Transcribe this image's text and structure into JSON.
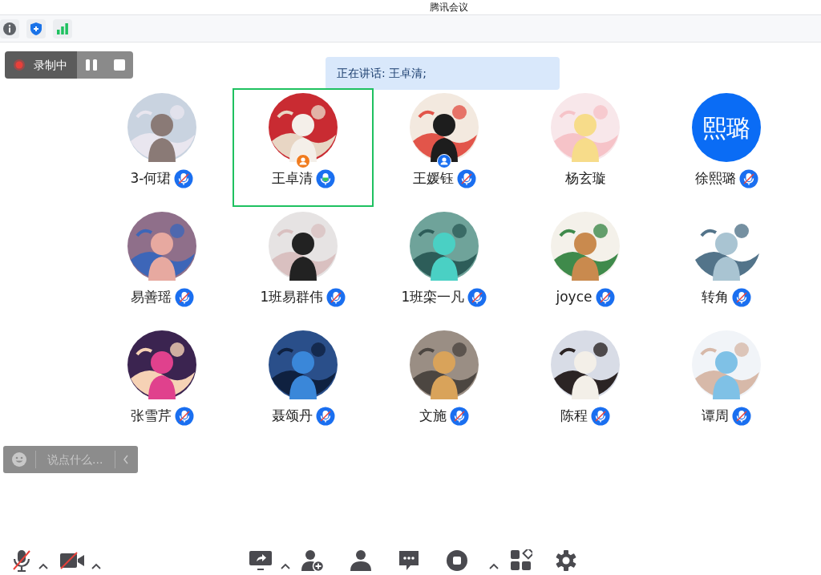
{
  "window": {
    "title": "腾讯会议"
  },
  "status_icons": [
    {
      "kind": "info"
    },
    {
      "kind": "shield"
    },
    {
      "kind": "signal"
    }
  ],
  "recording": {
    "label": "录制中"
  },
  "speaking_banner": {
    "text": "正在讲话: 王卓清;"
  },
  "participants": [
    {
      "name": "3-何珺",
      "kind": "picture",
      "mic_icon": true,
      "muted": true,
      "speaking": false,
      "host": false,
      "cohost": false,
      "selected": false
    },
    {
      "name": "王卓清",
      "kind": "picture",
      "mic_icon": true,
      "muted": false,
      "speaking": true,
      "host": true,
      "cohost": false,
      "selected": true
    },
    {
      "name": "王媛钰",
      "kind": "picture",
      "mic_icon": true,
      "muted": true,
      "speaking": false,
      "host": false,
      "cohost": true,
      "selected": false
    },
    {
      "name": "杨玄璇",
      "kind": "picture",
      "mic_icon": false,
      "host": false,
      "cohost": false,
      "selected": false
    },
    {
      "name": "徐熙璐",
      "kind": "text",
      "avatar_text": "熙璐",
      "mic_icon": true,
      "muted": true,
      "speaking": false,
      "host": false,
      "cohost": false,
      "selected": false
    },
    {
      "name": "易善瑶",
      "kind": "picture",
      "mic_icon": true,
      "muted": true,
      "speaking": false,
      "host": false,
      "cohost": false,
      "selected": false
    },
    {
      "name": "1班易群伟",
      "kind": "picture",
      "mic_icon": true,
      "muted": true,
      "speaking": false,
      "host": false,
      "cohost": false,
      "selected": false
    },
    {
      "name": "1班栾一凡",
      "kind": "picture",
      "mic_icon": true,
      "muted": true,
      "speaking": false,
      "host": false,
      "cohost": false,
      "selected": false
    },
    {
      "name": "joyce",
      "kind": "picture",
      "mic_icon": true,
      "muted": true,
      "speaking": false,
      "host": false,
      "cohost": false,
      "selected": false
    },
    {
      "name": "转角",
      "kind": "picture",
      "mic_icon": true,
      "muted": true,
      "speaking": false,
      "host": false,
      "cohost": false,
      "selected": false
    },
    {
      "name": "张雪芹",
      "kind": "picture",
      "mic_icon": true,
      "muted": true,
      "speaking": false,
      "host": false,
      "cohost": false,
      "selected": false
    },
    {
      "name": "聂颂丹",
      "kind": "picture",
      "mic_icon": true,
      "muted": true,
      "speaking": false,
      "host": false,
      "cohost": false,
      "selected": false
    },
    {
      "name": "文施",
      "kind": "picture",
      "mic_icon": true,
      "muted": true,
      "speaking": false,
      "host": false,
      "cohost": false,
      "selected": false
    },
    {
      "name": "陈程",
      "kind": "picture",
      "mic_icon": true,
      "muted": true,
      "speaking": false,
      "host": false,
      "cohost": false,
      "selected": false
    },
    {
      "name": "谭周",
      "kind": "picture",
      "mic_icon": true,
      "muted": true,
      "speaking": false,
      "host": false,
      "cohost": false,
      "selected": false
    }
  ],
  "chat_input": {
    "placeholder": "说点什么..."
  },
  "toolbar": [
    {
      "kind": "mic"
    },
    {
      "kind": "caret"
    },
    {
      "kind": "camera"
    },
    {
      "kind": "caret"
    },
    {
      "kind": "gap"
    },
    {
      "kind": "share"
    },
    {
      "kind": "caret"
    },
    {
      "kind": "invite"
    },
    {
      "kind": "members"
    },
    {
      "kind": "chat"
    },
    {
      "kind": "record"
    },
    {
      "kind": "caret"
    },
    {
      "kind": "apps"
    },
    {
      "kind": "settings"
    }
  ]
}
